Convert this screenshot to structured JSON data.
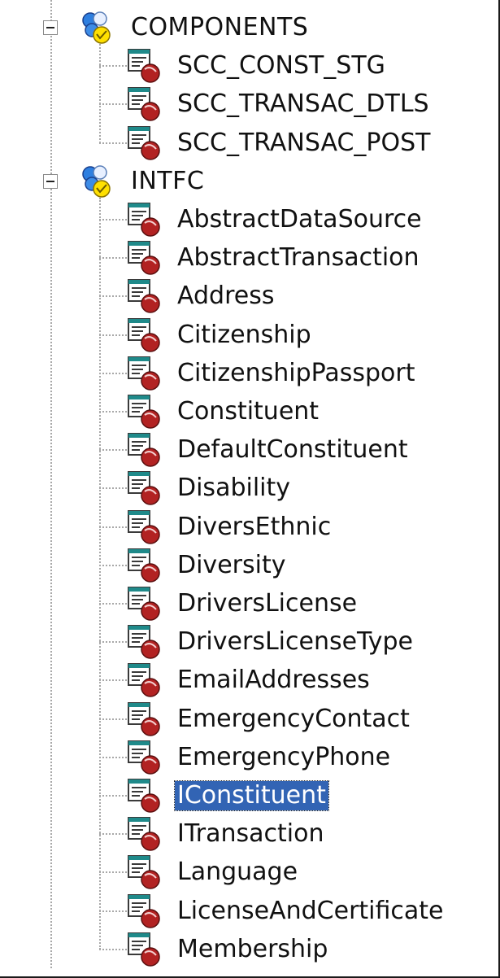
{
  "colors": {
    "selection_bg": "#3264b4",
    "selection_fg": "#ffffff",
    "tree_lines": "#a8a8a8"
  },
  "tree": {
    "groups": [
      {
        "label": "COMPONENTS",
        "expanded": true,
        "expander_icon": "minus-box-icon",
        "icon": "component-group-icon",
        "items": [
          {
            "label": "SCC_CONST_STG",
            "icon": "component-interface-icon"
          },
          {
            "label": "SCC_TRANSAC_DTLS",
            "icon": "component-interface-icon"
          },
          {
            "label": "SCC_TRANSAC_POST",
            "icon": "component-interface-icon"
          }
        ]
      },
      {
        "label": "INTFC",
        "expanded": true,
        "expander_icon": "minus-box-icon",
        "icon": "component-group-icon",
        "items": [
          {
            "label": "AbstractDataSource",
            "icon": "component-interface-icon"
          },
          {
            "label": "AbstractTransaction",
            "icon": "component-interface-icon"
          },
          {
            "label": "Address",
            "icon": "component-interface-icon"
          },
          {
            "label": "Citizenship",
            "icon": "component-interface-icon"
          },
          {
            "label": "CitizenshipPassport",
            "icon": "component-interface-icon"
          },
          {
            "label": "Constituent",
            "icon": "component-interface-icon"
          },
          {
            "label": "DefaultConstituent",
            "icon": "component-interface-icon"
          },
          {
            "label": "Disability",
            "icon": "component-interface-icon"
          },
          {
            "label": "DiversEthnic",
            "icon": "component-interface-icon"
          },
          {
            "label": "Diversity",
            "icon": "component-interface-icon"
          },
          {
            "label": "DriversLicense",
            "icon": "component-interface-icon"
          },
          {
            "label": "DriversLicenseType",
            "icon": "component-interface-icon"
          },
          {
            "label": "EmailAddresses",
            "icon": "component-interface-icon"
          },
          {
            "label": "EmergencyContact",
            "icon": "component-interface-icon"
          },
          {
            "label": "EmergencyPhone",
            "icon": "component-interface-icon"
          },
          {
            "label": "IConstituent",
            "icon": "component-interface-icon",
            "selected": true
          },
          {
            "label": "ITransaction",
            "icon": "component-interface-icon"
          },
          {
            "label": "Language",
            "icon": "component-interface-icon"
          },
          {
            "label": "LicenseAndCertificate",
            "icon": "component-interface-icon"
          },
          {
            "label": "Membership",
            "icon": "component-interface-icon"
          }
        ]
      }
    ]
  }
}
